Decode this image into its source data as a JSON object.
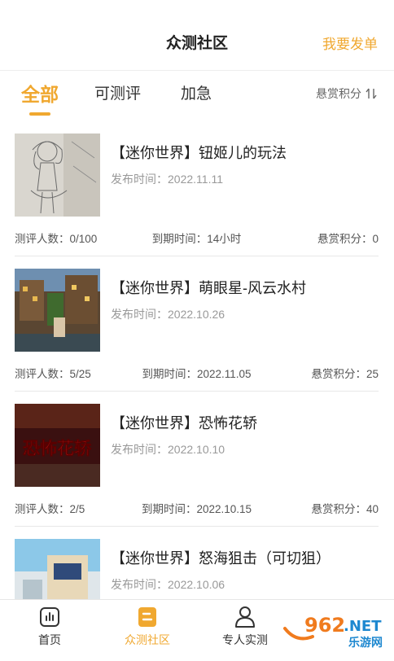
{
  "header": {
    "title": "众测社区",
    "action_label": "我要发单"
  },
  "tabs": [
    {
      "label": "全部",
      "active": true
    },
    {
      "label": "可测评",
      "active": false
    },
    {
      "label": "加急",
      "active": false
    }
  ],
  "sort": {
    "label": "悬赏积分"
  },
  "tasks": [
    {
      "title": "【迷你世界】钮姬儿的玩法",
      "date": "发布时间：2022.11.11",
      "reviewers": "测评人数：0/100",
      "deadline": "到期时间：14小时",
      "reward": "悬赏积分：0",
      "thumb_text": ""
    },
    {
      "title": "【迷你世界】萌眼星-风云水村",
      "date": "发布时间：2022.10.26",
      "reviewers": "测评人数：5/25",
      "deadline": "到期时间：2022.11.05",
      "reward": "悬赏积分：25",
      "thumb_text": ""
    },
    {
      "title": "【迷你世界】恐怖花轿",
      "date": "发布时间：2022.10.10",
      "reviewers": "测评人数：2/5",
      "deadline": "到期时间：2022.10.15",
      "reward": "悬赏积分：40",
      "thumb_text": "恐怖花轿"
    },
    {
      "title": "【迷你世界】怒海狙击（可切狙）",
      "date": "发布时间：2022.10.06",
      "reviewers": "",
      "deadline": "",
      "reward": "",
      "thumb_text": ""
    }
  ],
  "bottom_nav": [
    {
      "label": "首页",
      "icon": "chart-icon",
      "active": false
    },
    {
      "label": "众测社区",
      "icon": "community-icon",
      "active": true
    },
    {
      "label": "专人实测",
      "icon": "person-icon",
      "active": false
    }
  ],
  "watermark": {
    "brand": "962.NET",
    "sub": "乐游网"
  },
  "colors": {
    "accent": "#f0a830",
    "text": "#333333",
    "muted": "#999999",
    "divider": "#e8e8e8"
  }
}
